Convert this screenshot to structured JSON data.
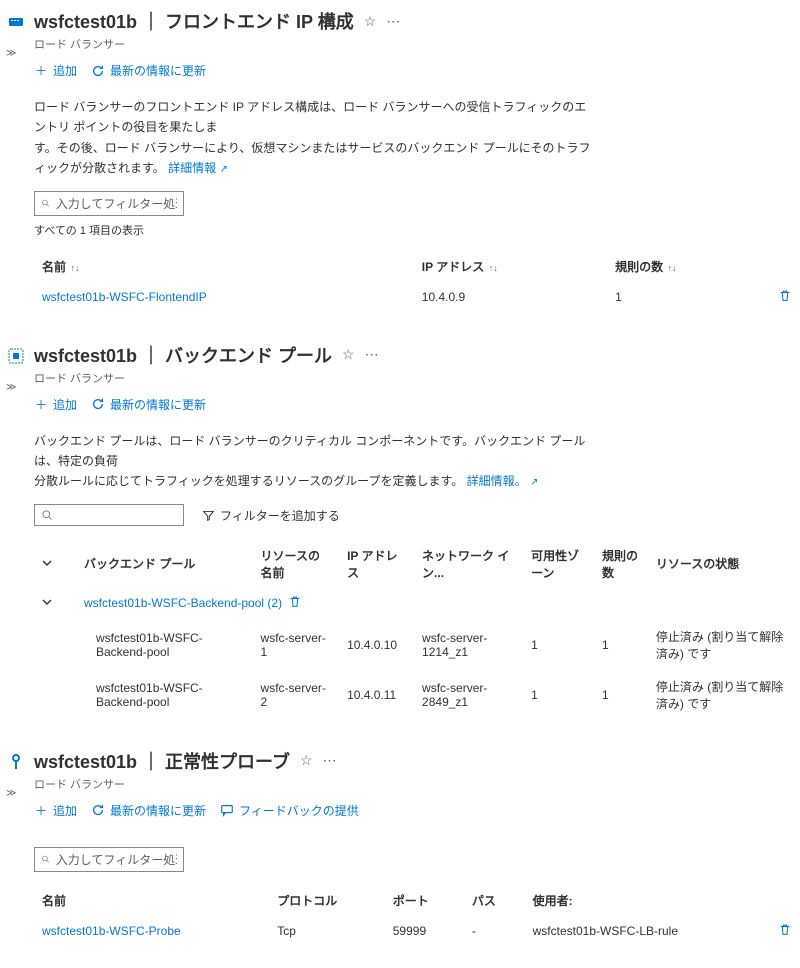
{
  "panels": {
    "frontend": {
      "title": "wsfctest01b ｜ フロントエンド IP 構成",
      "subtitle": "ロード バランサー",
      "cmds": {
        "add": "追加",
        "refresh": "最新の情報に更新"
      },
      "desc_line1": "ロード バランサーのフロントエンド IP アドレス構成は、ロード バランサーへの受信トラフィックのエントリ ポイントの役目を果たしま",
      "desc_line2": "す。その後、ロード バランサーにより、仮想マシンまたはサービスのバックエンド プールにそのトラフィックが分散されます。",
      "desc_link": "詳細情報",
      "search_ph": "入力してフィルター処理を開...",
      "count": "すべての 1 項目の表示",
      "cols": {
        "name": "名前",
        "ip": "IP アドレス",
        "rules": "規則の数"
      },
      "row": {
        "name": "wsfctest01b-WSFC-FlontendIP",
        "ip": "10.4.0.9",
        "rules": "1"
      }
    },
    "backend": {
      "title": "wsfctest01b ｜ バックエンド プール",
      "subtitle": "ロード バランサー",
      "cmds": {
        "add": "追加",
        "refresh": "最新の情報に更新"
      },
      "desc_line1": "バックエンド プールは、ロード バランサーのクリティカル コンポーネントです。バックエンド プールは、特定の負荷",
      "desc_line2": "分散ルールに応じてトラフィックを処理するリソースのグループを定義します。",
      "desc_link": "詳細情報。",
      "filter_btn": "フィルターを追加する",
      "cols": {
        "pool": "バックエンド プール",
        "res": "リソースの名前",
        "ip": "IP アドレス",
        "nic": "ネットワーク イン...",
        "zone": "可用性ゾーン",
        "rules": "規則の数",
        "state": "リソースの状態"
      },
      "group": "wsfctest01b-WSFC-Backend-pool (2)",
      "rows": [
        {
          "pool": "wsfctest01b-WSFC-Backend-pool",
          "res": "wsfc-server-1",
          "ip": "10.4.0.10",
          "nic": "wsfc-server-1214_z1",
          "zone": "1",
          "rules": "1",
          "state": "停止済み (割り当て解除済み) です"
        },
        {
          "pool": "wsfctest01b-WSFC-Backend-pool",
          "res": "wsfc-server-2",
          "ip": "10.4.0.11",
          "nic": "wsfc-server-2849_z1",
          "zone": "1",
          "rules": "1",
          "state": "停止済み (割り当て解除済み) です"
        }
      ]
    },
    "probe": {
      "title": "wsfctest01b ｜ 正常性プローブ",
      "subtitle": "ロード バランサー",
      "cmds": {
        "add": "追加",
        "refresh": "最新の情報に更新",
        "feedback": "フィードバックの提供"
      },
      "search_ph": "入力してフィルター処理を開...",
      "cols": {
        "name": "名前",
        "proto": "プロトコル",
        "port": "ポート",
        "path": "パス",
        "usedby": "使用者:"
      },
      "row": {
        "name": "wsfctest01b-WSFC-Probe",
        "proto": "Tcp",
        "port": "59999",
        "path": "-",
        "usedby": "wsfctest01b-WSFC-LB-rule"
      }
    }
  }
}
